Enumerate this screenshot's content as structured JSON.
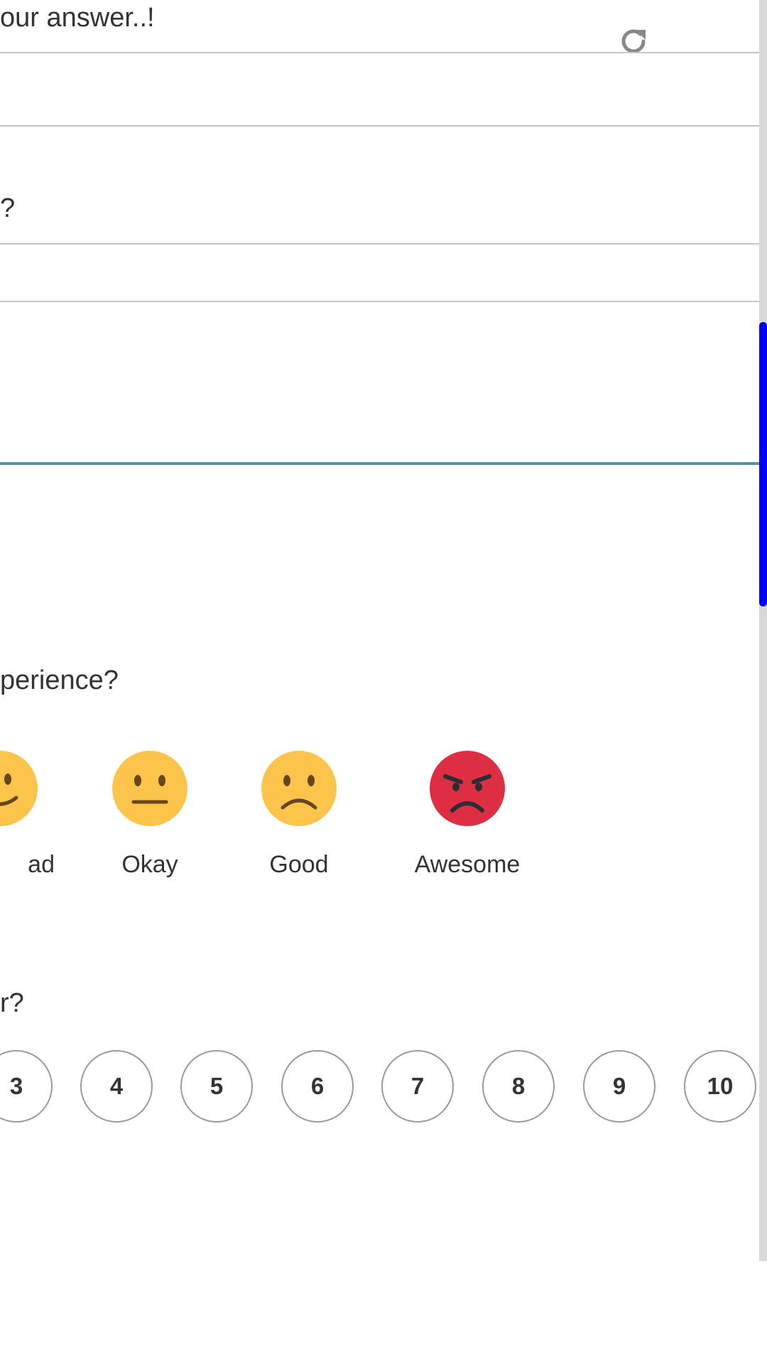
{
  "colors": {
    "accent_line": "#5e8fa0",
    "scrollbar_thumb": "#0000ff",
    "emoji_yellow": "#fcc44b",
    "emoji_red": "#dd2e44"
  },
  "answer_field": {
    "placeholder": "our answer..!"
  },
  "question_fragment_1": "?",
  "experience_question": {
    "text_fragment": "perience?",
    "options": [
      {
        "label": "ad",
        "icon": "slightly-smiling-face-icon"
      },
      {
        "label": "Okay",
        "icon": "neutral-face-icon"
      },
      {
        "label": "Good",
        "icon": "frowning-face-icon"
      },
      {
        "label": "Awesome",
        "icon": "angry-face-icon"
      }
    ]
  },
  "nps_question": {
    "text_fragment": "r?",
    "options": [
      "3",
      "4",
      "5",
      "6",
      "7",
      "8",
      "9",
      "10"
    ]
  }
}
